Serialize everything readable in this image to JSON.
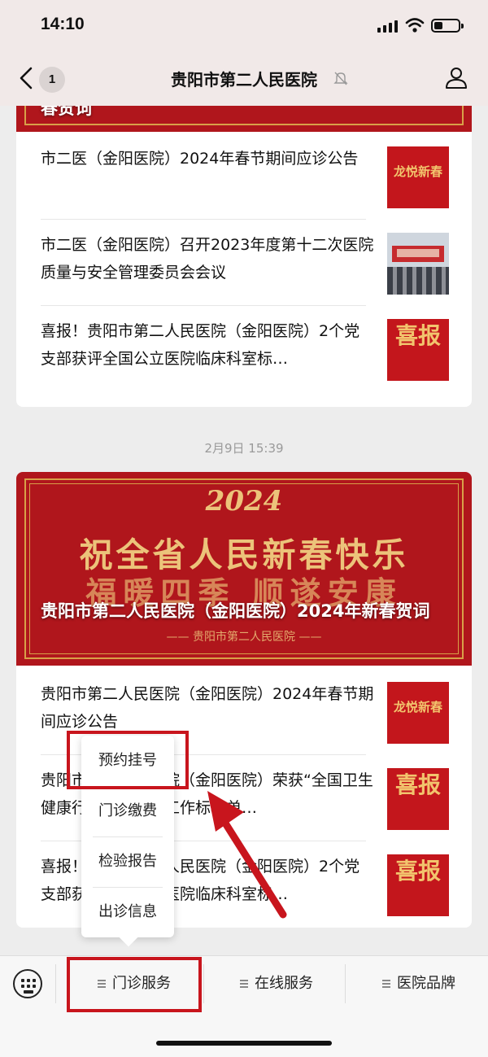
{
  "status_bar": {
    "time": "14:10"
  },
  "nav": {
    "badge": "1",
    "title": "贵阳市第二人民医院"
  },
  "card1": {
    "banner_title": "春贺词",
    "items": [
      {
        "text": "市二医（金阳医院）2024年春节期间应诊公告",
        "thumb": "龙悦新春"
      },
      {
        "text": "市二医（金阳医院）召开2023年度第十二次医院质量与安全管理委员会会议",
        "thumb": ""
      },
      {
        "text": "喜报！贵阳市第二人民医院（金阳医院）2个党支部获评全国公立医院临床科室标…",
        "thumb": "喜报"
      }
    ]
  },
  "timestamp": "2月9日 15:39",
  "card2": {
    "banner": {
      "year": "2024",
      "line1": "祝全省人民新春快乐",
      "line2": "福暖四季 顺遂安康",
      "sub": "—— 贵阳市第二人民医院 ——",
      "title": "贵阳市第二人民医院（金阳医院）2024年新春贺词"
    },
    "items": [
      {
        "text": "贵阳市第二人民医院（金阳医院）2024年春节期间应诊公告",
        "thumb": "龙悦新春"
      },
      {
        "text": "贵阳市第二人民医院（金阳医院）荣获“全国卫生健康行业思想政治工作标杆单…",
        "thumb": "喜报"
      },
      {
        "text": "喜报！贵阳市第二人民医院（金阳医院）2个党支部获评全国公立医院临床科室标…",
        "thumb": "喜报"
      }
    ]
  },
  "popup_menu": {
    "items": [
      "预约挂号",
      "门诊缴费",
      "检验报告",
      "出诊信息"
    ]
  },
  "bottom_bar": {
    "tabs": [
      "门诊服务",
      "在线服务",
      "医院品牌"
    ]
  },
  "colors": {
    "annotation_red": "#c8151d",
    "banner_red": "#b0161c",
    "gold": "#ecc37a"
  }
}
